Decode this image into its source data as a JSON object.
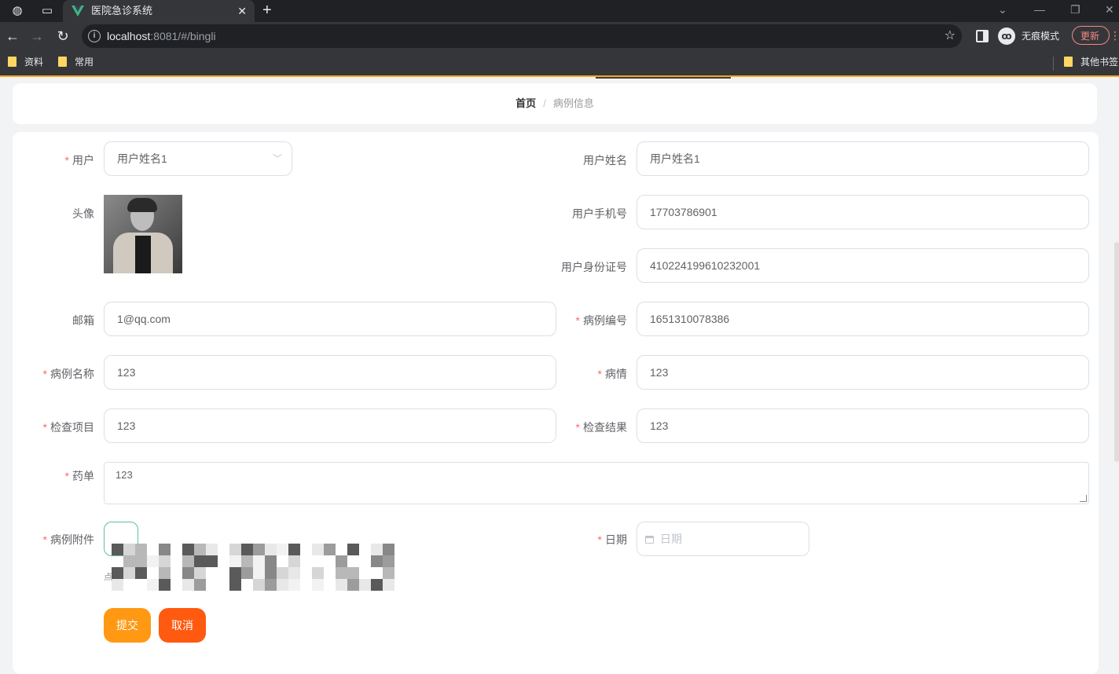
{
  "browser": {
    "tab_title": "医院急诊系统",
    "url_host": "localhost",
    "url_rest": ":8081/#/bingli",
    "incognito_label": "无痕模式",
    "update_label": "更新",
    "bookmarks": [
      "资料",
      "常用"
    ],
    "other_bookmarks": "其他书签"
  },
  "breadcrumb": {
    "home": "首页",
    "separator": "/",
    "current": "病例信息"
  },
  "form": {
    "user": {
      "label": "用户",
      "value": "用户姓名1"
    },
    "user_name": {
      "label": "用户姓名",
      "value": "用户姓名1"
    },
    "avatar": {
      "label": "头像"
    },
    "phone": {
      "label": "用户手机号",
      "value": "17703786901"
    },
    "id_card": {
      "label": "用户身份证号",
      "value": "410224199610232001"
    },
    "email": {
      "label": "邮箱",
      "value": "1@qq.com"
    },
    "case_no": {
      "label": "病例编号",
      "value": "1651310078386"
    },
    "case_name": {
      "label": "病例名称",
      "value": "123"
    },
    "condition": {
      "label": "病情",
      "value": "123"
    },
    "exam_item": {
      "label": "检查项目",
      "value": "123"
    },
    "exam_result": {
      "label": "检查结果",
      "value": "123"
    },
    "prescription": {
      "label": "药单",
      "value": "123"
    },
    "attachment": {
      "label": "病例附件",
      "hint": "点"
    },
    "date": {
      "label": "日期",
      "placeholder": "日期"
    },
    "required_mark": "*"
  },
  "buttons": {
    "submit": "提交",
    "cancel": "取消"
  },
  "colors": {
    "submit": "#ff9913",
    "cancel": "#ff5a0f",
    "required": "#f56c6c"
  }
}
